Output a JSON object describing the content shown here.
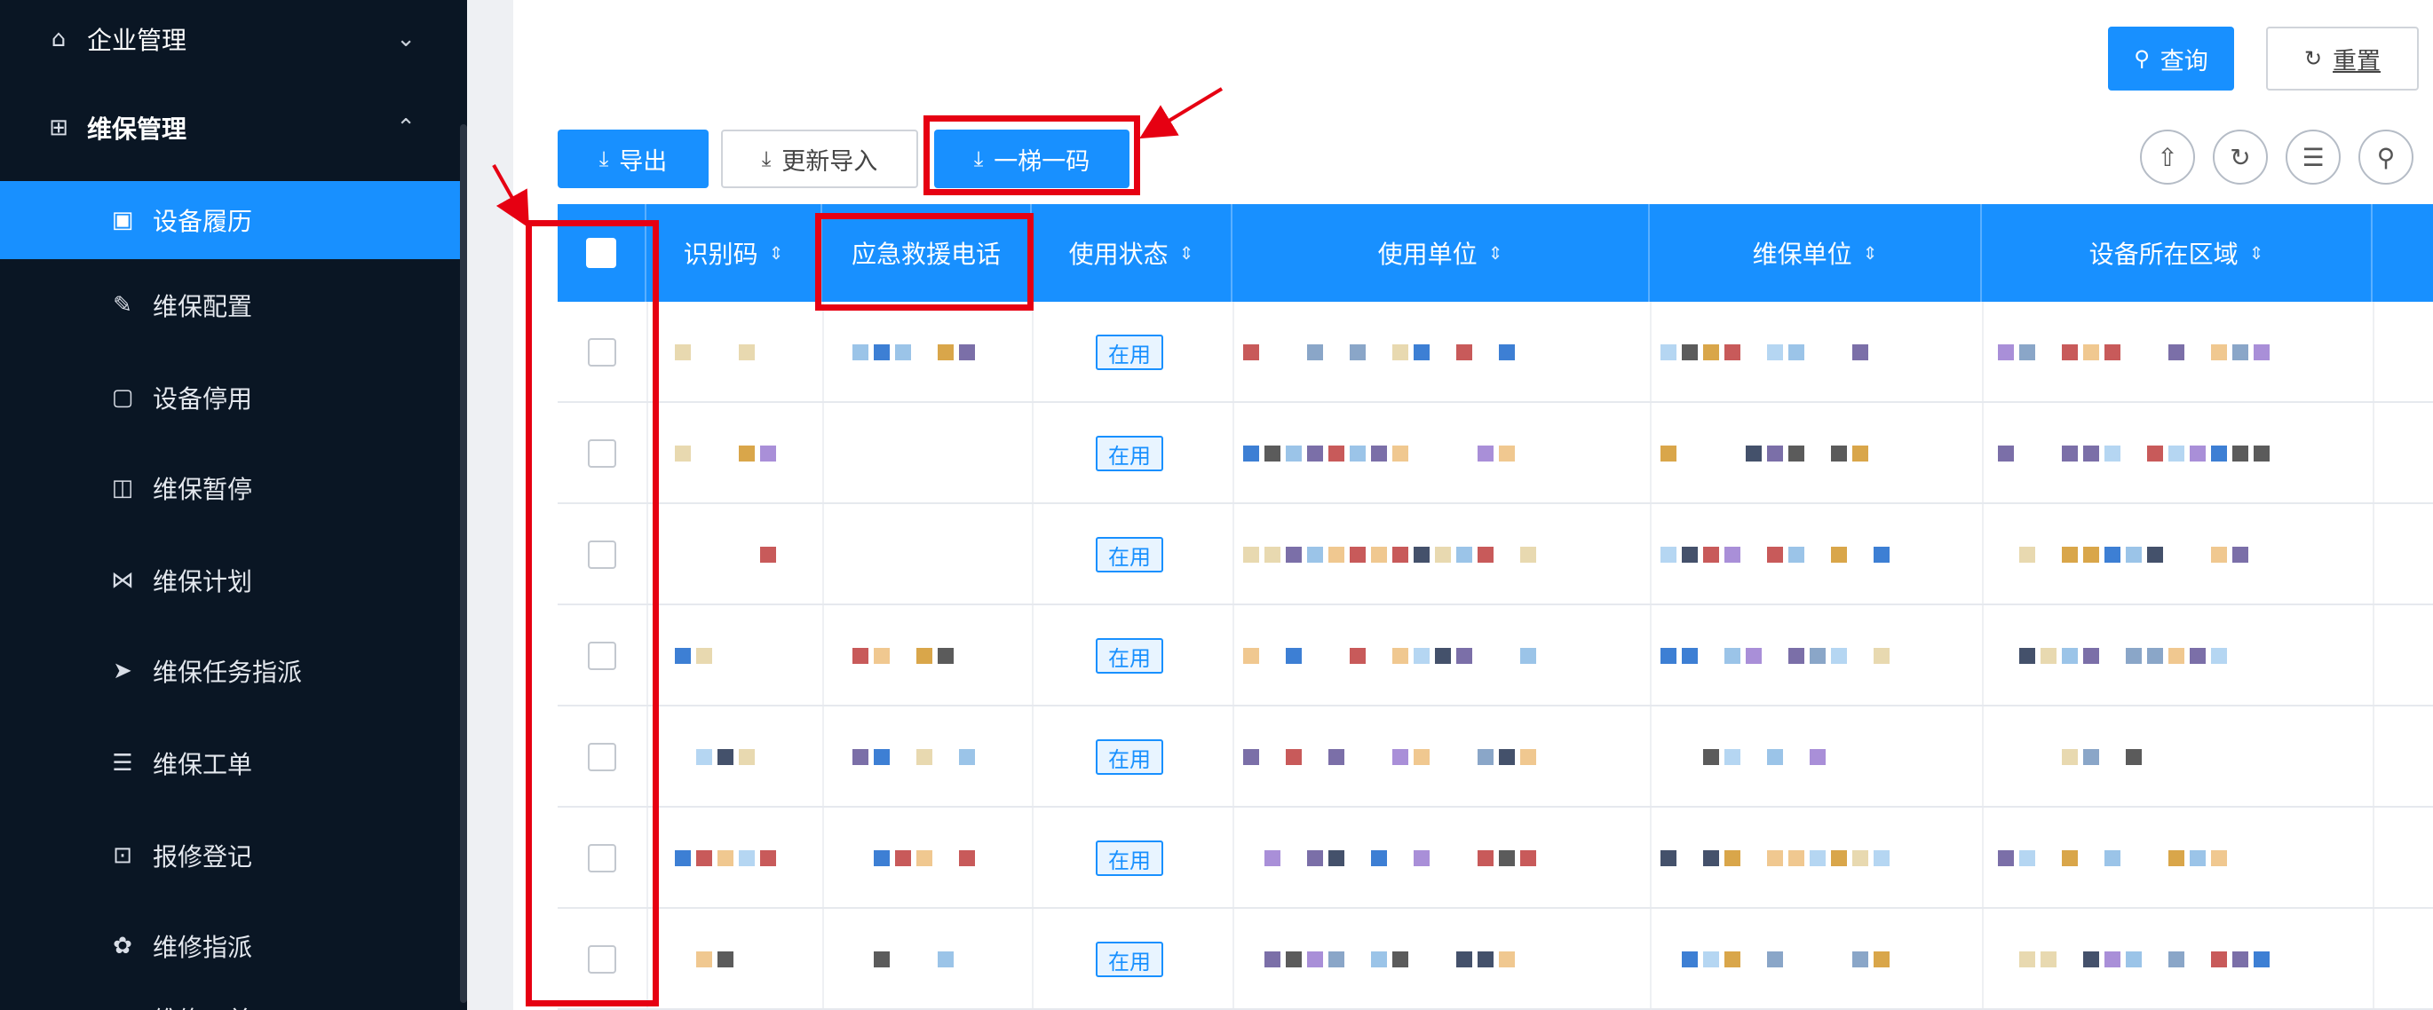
{
  "sidebar": {
    "items": [
      {
        "label": "企业管理",
        "icon": "home-icon",
        "glyph": "⌂",
        "chevron": "⌄"
      },
      {
        "label": "维保管理",
        "icon": "grid-icon",
        "glyph": "⊞",
        "chevron": "⌃"
      },
      {
        "label": "设备履历",
        "icon": "document-icon",
        "glyph": "▣"
      },
      {
        "label": "维保配置",
        "icon": "edit-icon",
        "glyph": "✎"
      },
      {
        "label": "设备停用",
        "icon": "file-icon",
        "glyph": "▢"
      },
      {
        "label": "维保暂停",
        "icon": "pause-icon",
        "glyph": "◫"
      },
      {
        "label": "维保计划",
        "icon": "plan-icon",
        "glyph": "⋈"
      },
      {
        "label": "维保任务指派",
        "icon": "send-icon",
        "glyph": "➤"
      },
      {
        "label": "维保工单",
        "icon": "list-icon",
        "glyph": "☰"
      },
      {
        "label": "报修登记",
        "icon": "register-icon",
        "glyph": "⊡"
      },
      {
        "label": "维修指派",
        "icon": "gear-icon",
        "glyph": "✿"
      },
      {
        "label": "维修工单",
        "icon": "order-icon",
        "glyph": "⊟"
      }
    ],
    "active_index": 2
  },
  "search": {
    "query_label": "查询",
    "reset_label": "重置",
    "query_icon": "⚲",
    "reset_icon": "↻"
  },
  "toolbar": {
    "export_label": "导出",
    "update_import_label": "更新导入",
    "ladder_code_label": "一梯一码",
    "icon": "⤓"
  },
  "tool_icons": [
    {
      "name": "upload-cloud-icon",
      "glyph": "⇧"
    },
    {
      "name": "refresh-icon",
      "glyph": "↻"
    },
    {
      "name": "column-settings-icon",
      "glyph": "☰"
    },
    {
      "name": "search-icon",
      "glyph": "⚲"
    }
  ],
  "table": {
    "columns": [
      "识别码",
      "应急救援电话",
      "使用状态",
      "使用单位",
      "维保单位",
      "设备所在区域"
    ],
    "sort_glyph": "⇕",
    "rows": [
      {
        "status": "在用"
      },
      {
        "status": "在用"
      },
      {
        "status": "在用"
      },
      {
        "status": "在用"
      },
      {
        "status": "在用"
      },
      {
        "status": "在用"
      },
      {
        "status": "在用"
      }
    ]
  },
  "colors": {
    "accent": "#1890ff",
    "sidebar_bg": "#0a1624",
    "highlight": "#e60012"
  }
}
